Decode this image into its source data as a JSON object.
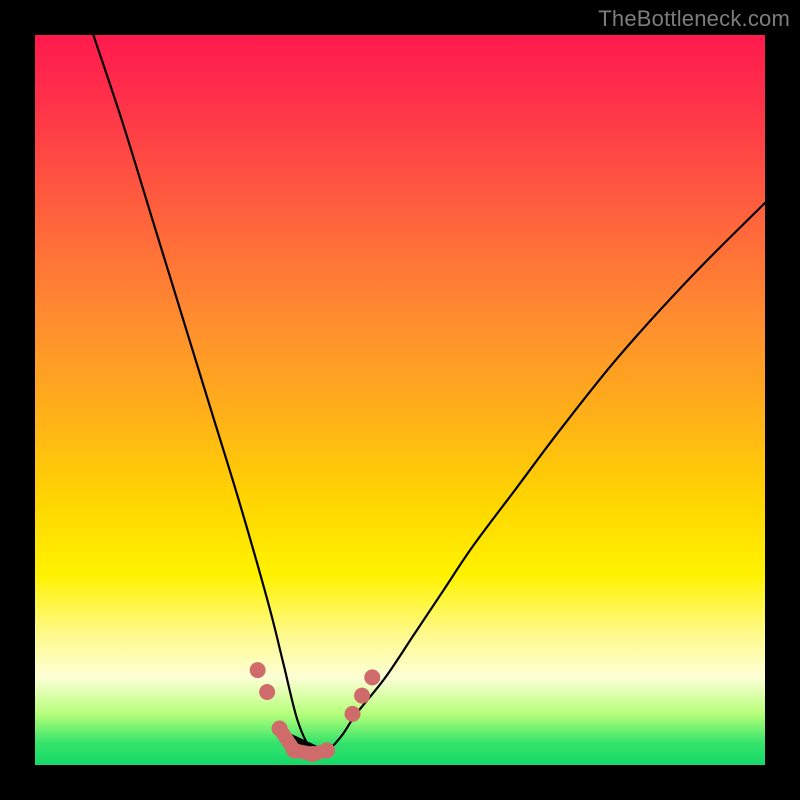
{
  "watermark": "TheBottleneck.com",
  "chart_data": {
    "type": "line",
    "title": "",
    "xlabel": "",
    "ylabel": "",
    "xlim": [
      0,
      100
    ],
    "ylim": [
      0,
      100
    ],
    "grid": false,
    "legend": false,
    "note": "V-shaped bottleneck curve over red→green vertical gradient; minimum near x≈37; values estimated from pixel proportions (no visible axis ticks).",
    "series": [
      {
        "name": "bottleneck-curve",
        "x": [
          8,
          12,
          16,
          20,
          24,
          28,
          32,
          34,
          36,
          38,
          40,
          42,
          44,
          48,
          52,
          56,
          60,
          66,
          72,
          80,
          90,
          100
        ],
        "values": [
          100,
          88,
          75,
          62,
          49,
          36,
          22,
          14,
          6,
          2,
          2,
          4,
          7,
          12,
          18,
          24,
          30,
          38,
          46,
          56,
          67,
          77
        ]
      }
    ],
    "markers": {
      "name": "bottom-cluster",
      "color": "#cf6b6b",
      "points": [
        {
          "x": 30.5,
          "y": 13
        },
        {
          "x": 31.8,
          "y": 10
        },
        {
          "x": 33.5,
          "y": 5
        },
        {
          "x": 35.5,
          "y": 2
        },
        {
          "x": 38.0,
          "y": 1.5
        },
        {
          "x": 40.0,
          "y": 2
        },
        {
          "x": 43.5,
          "y": 7
        },
        {
          "x": 44.8,
          "y": 9.5
        },
        {
          "x": 46.2,
          "y": 12
        }
      ]
    }
  }
}
